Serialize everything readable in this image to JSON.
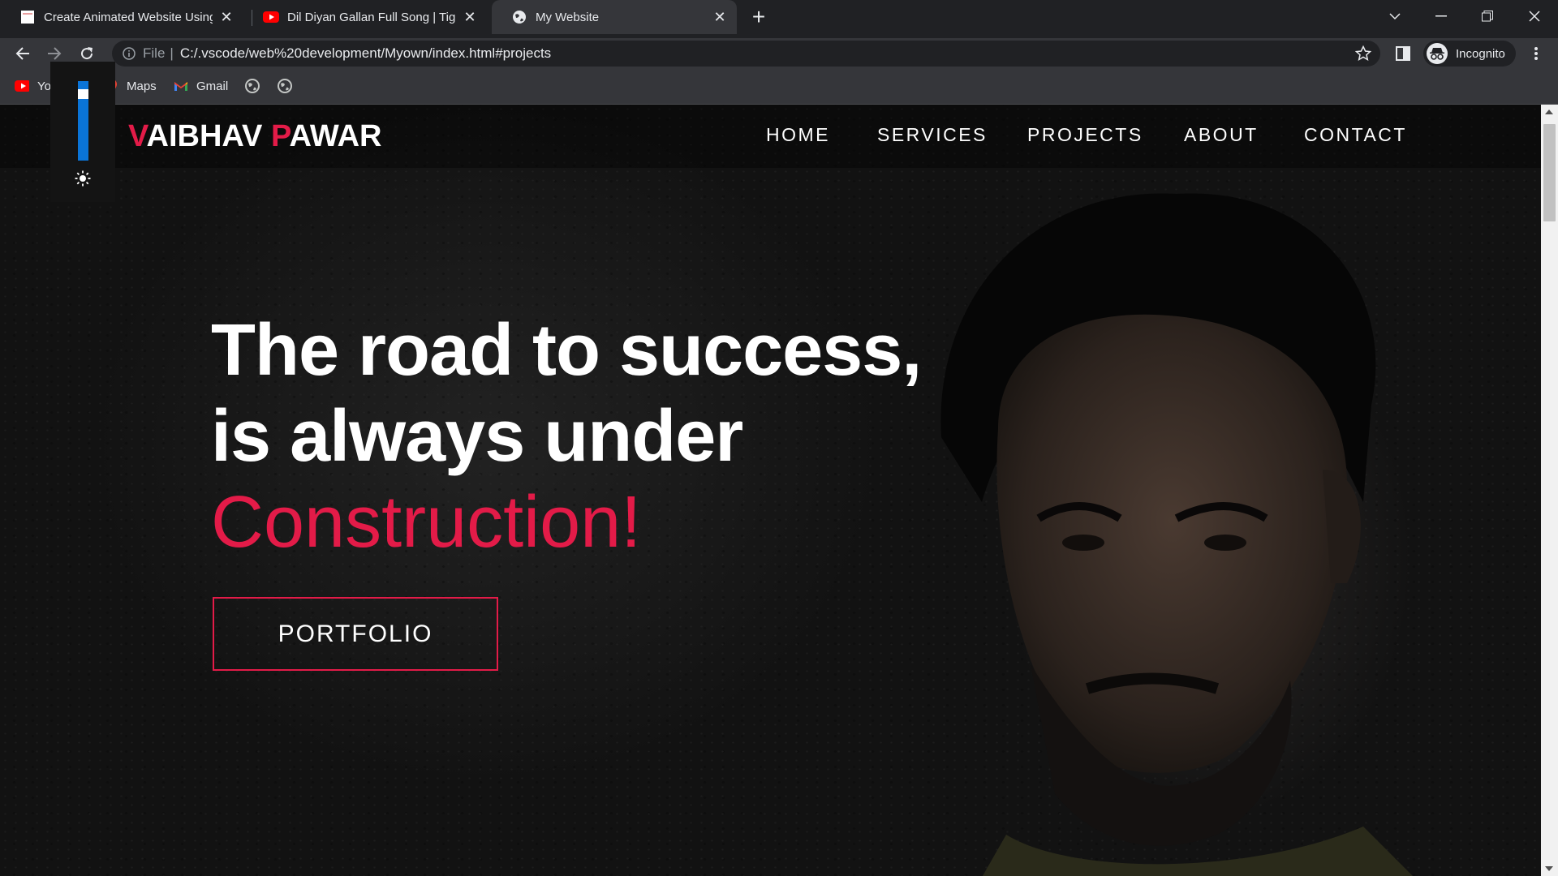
{
  "browser": {
    "tabs": [
      {
        "title": "Create Animated Website Using HTML CSS",
        "favicon": "page-icon"
      },
      {
        "title": "Dil Diyan Gallan Full Song | Tiger Zinda Hai",
        "favicon": "youtube-icon"
      },
      {
        "title": "My Website",
        "favicon": "globe-icon",
        "active": true
      }
    ],
    "address": {
      "scheme_label": "File",
      "url": "C:/.vscode/web%20development/Myown/index.html#projects"
    },
    "profile_label": "Incognito",
    "bookmarks": [
      {
        "label": "YouTube",
        "icon": "youtube-icon"
      },
      {
        "label": "Maps",
        "icon": "maps-icon"
      },
      {
        "label": "Gmail",
        "icon": "gmail-icon"
      },
      {
        "label": "",
        "icon": "globe-icon"
      },
      {
        "label": "",
        "icon": "globe-icon"
      }
    ]
  },
  "site": {
    "logo": {
      "first_initial": "V",
      "first_rest": "AIBHAV ",
      "last_initial": "P",
      "last_rest": "AWAR"
    },
    "nav": [
      "HOME",
      "SERVICES",
      "PROJECTS",
      "ABOUT",
      "CONTACT"
    ],
    "hero": {
      "line1": "The road to success,",
      "line2": "is always under",
      "accent": "Construction!",
      "button": "PORTFOLIO"
    },
    "colors": {
      "accent": "#e31b48",
      "background": "#101010"
    }
  },
  "brightness_widget": {
    "level": 0.88,
    "icon": "sun-icon"
  }
}
